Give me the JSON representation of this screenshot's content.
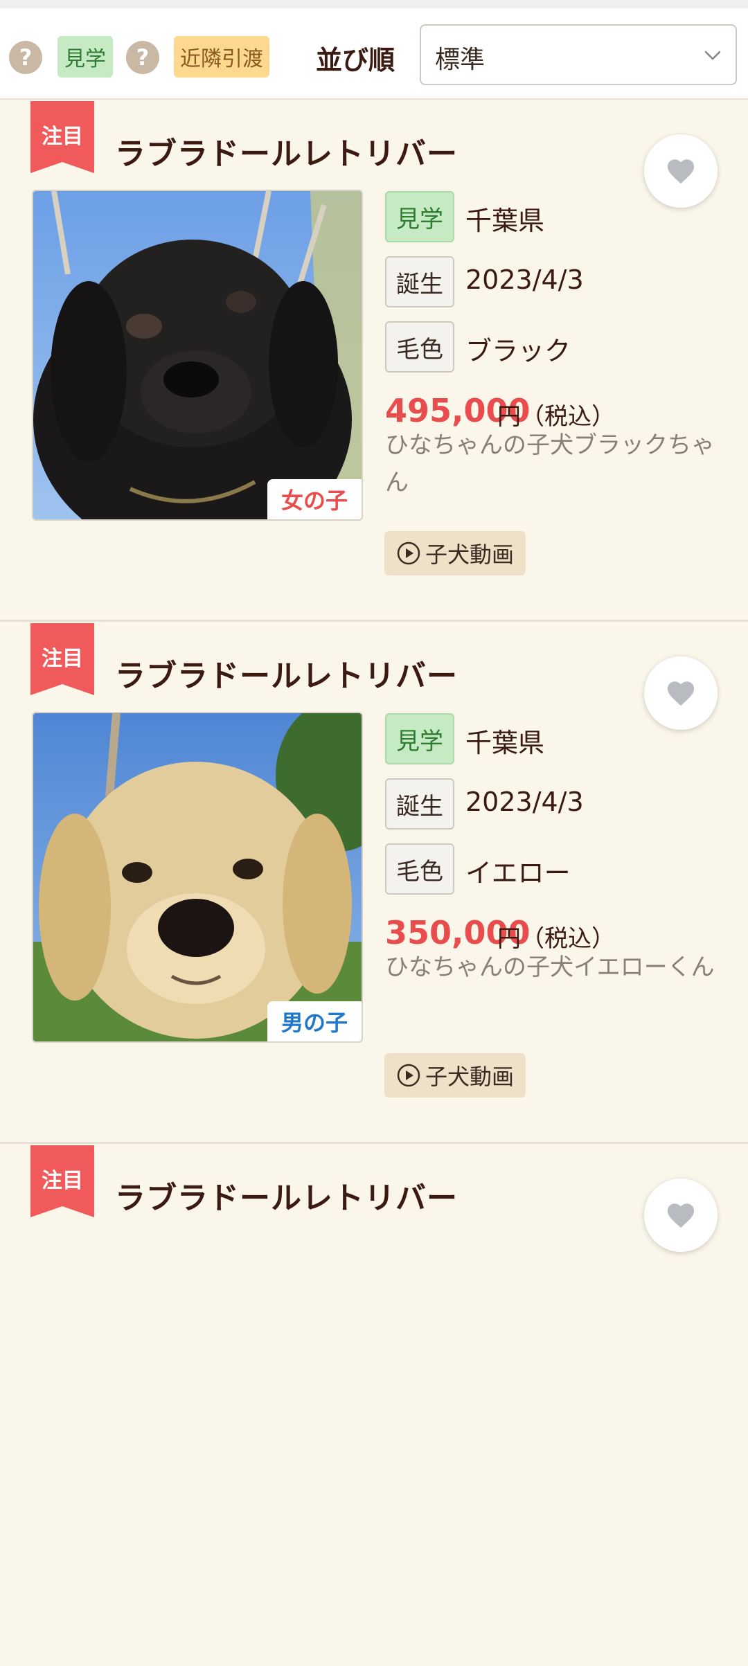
{
  "filter_bar": {
    "tag_visit": "見学",
    "tag_nearby": "近隣引渡",
    "help_icon_glyph": "?",
    "sort_label": "並び順",
    "sort_value": "標準"
  },
  "listings": [
    {
      "ribbon": "注目",
      "breed": "ラブラドールレトリバー",
      "visit_label": "見学",
      "location": "千葉県",
      "birth_label": "誕生",
      "birth_date": "2023/4/3",
      "color_label": "毛色",
      "color": "ブラック",
      "price": "495,000",
      "price_suffix": "円（税込）",
      "description": "ひなちゃんの子犬ブラックちゃん",
      "gender": "女の子",
      "gender_color": "#e84c4c",
      "video_label": "子犬動画"
    },
    {
      "ribbon": "注目",
      "breed": "ラブラドールレトリバー",
      "visit_label": "見学",
      "location": "千葉県",
      "birth_label": "誕生",
      "birth_date": "2023/4/3",
      "color_label": "毛色",
      "color": "イエロー",
      "price": "350,000",
      "price_suffix": "円（税込）",
      "description": "ひなちゃんの子犬イエローくん",
      "gender": "男の子",
      "gender_color": "#1f78c8",
      "video_label": "子犬動画"
    },
    {
      "ribbon": "注目",
      "breed": "ラブラドールレトリバー"
    }
  ],
  "colors": {
    "background": "#fbf6ea",
    "ribbon": "#f05a5a",
    "price": "#e84c4c",
    "visit_tag": "#c6ebc4",
    "nearby_tag": "#fdd98f",
    "video_button": "#ede1c8"
  },
  "icons": [
    "help-icon",
    "chevron-down-icon",
    "heart-icon",
    "play-circle-icon"
  ]
}
